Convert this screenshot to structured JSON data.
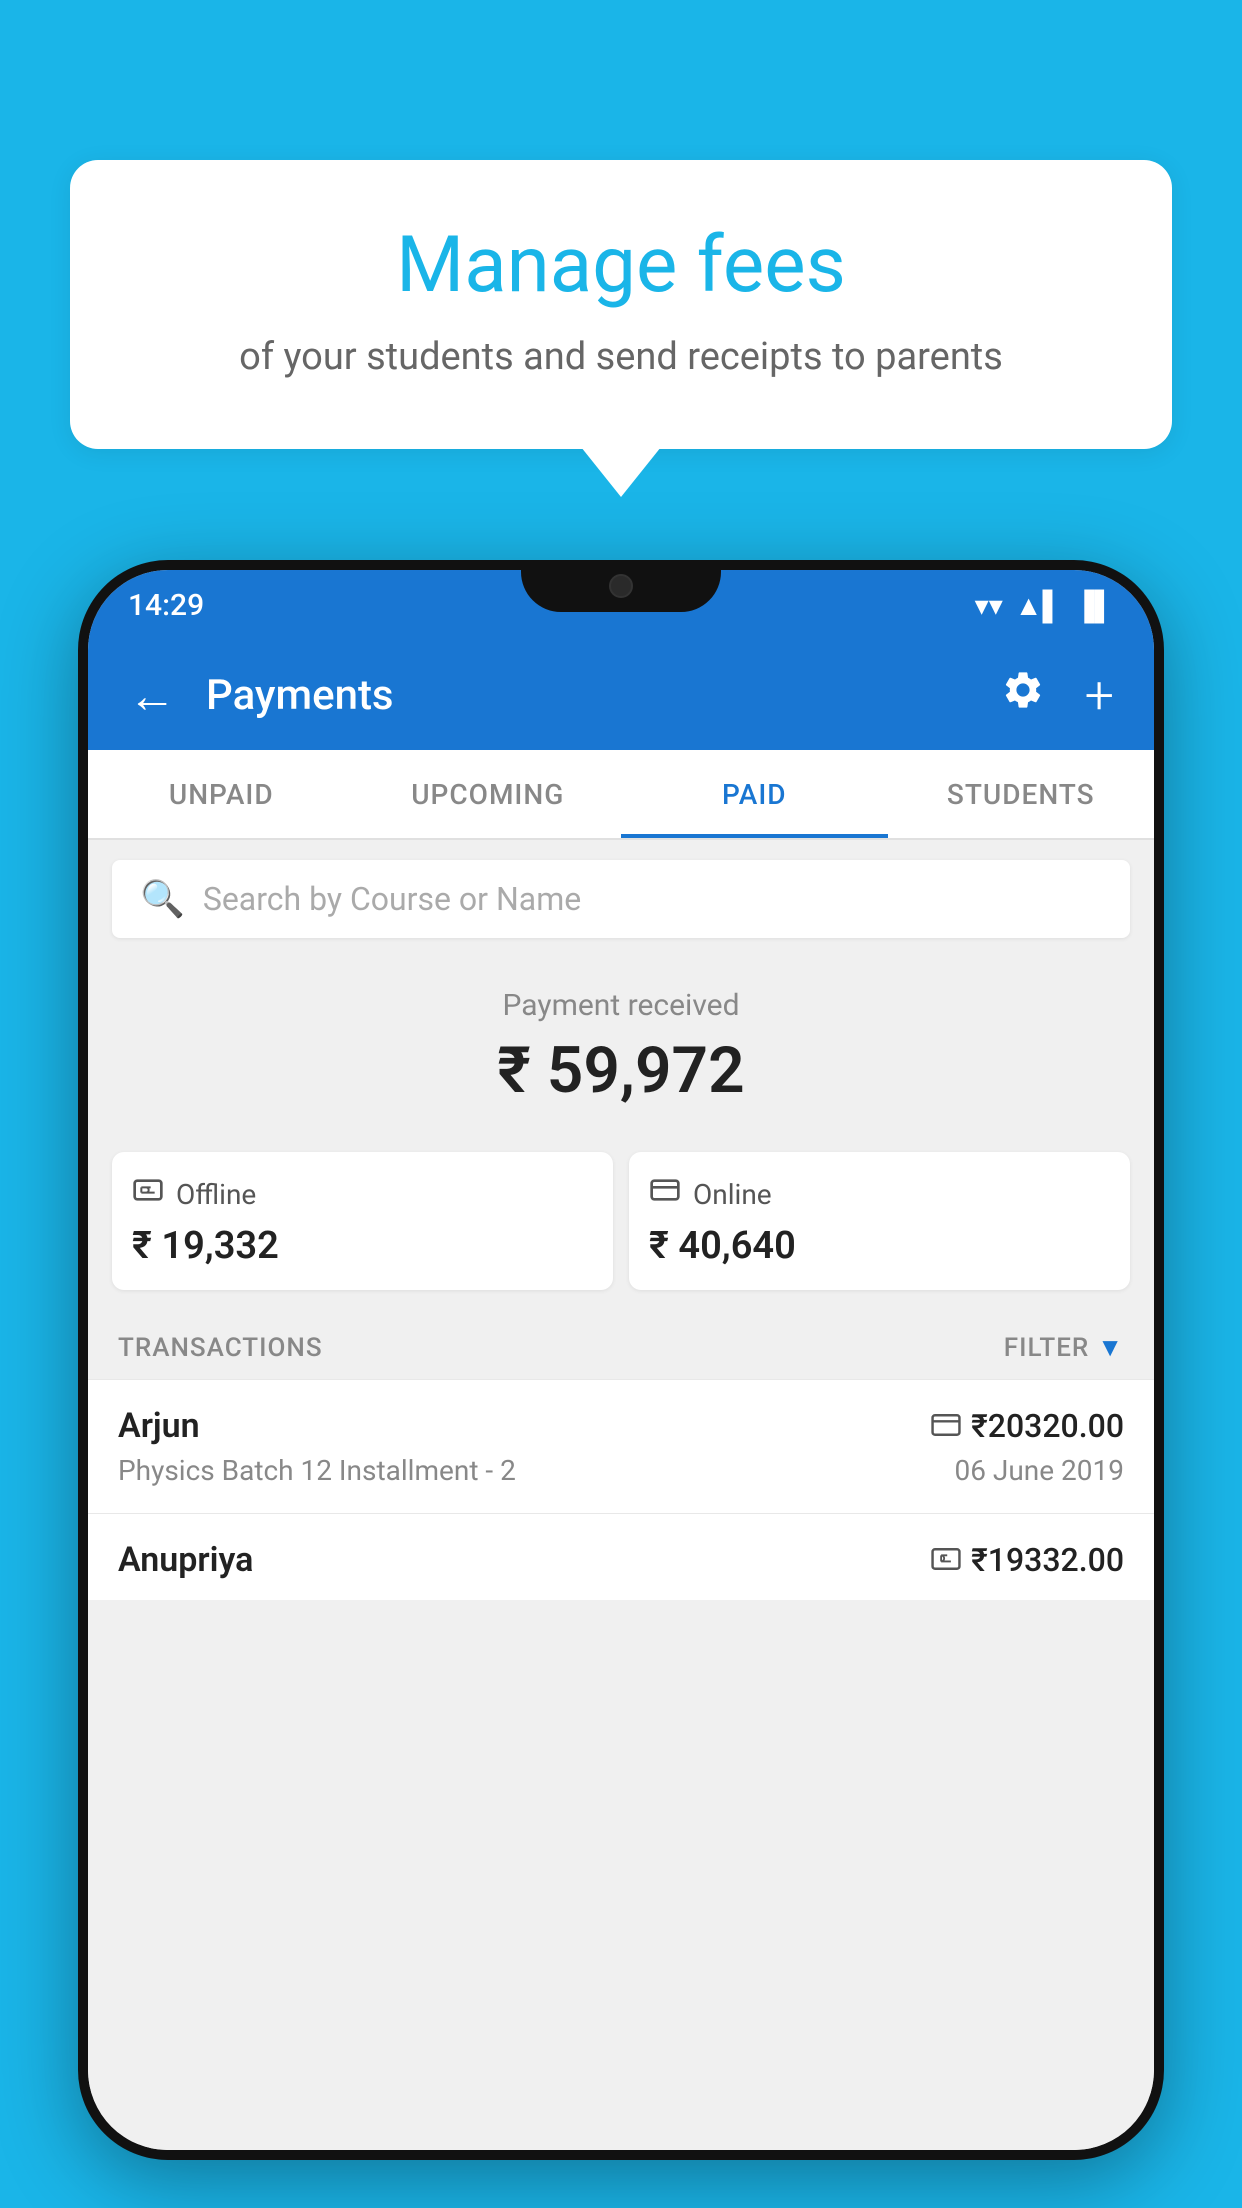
{
  "background_color": "#1ab5e8",
  "bubble": {
    "title": "Manage fees",
    "subtitle": "of your students and send receipts to parents"
  },
  "status_bar": {
    "time": "14:29",
    "wifi": "▼",
    "signal": "▲",
    "battery": "▐"
  },
  "app_bar": {
    "title": "Payments",
    "back_label": "←",
    "settings_label": "⚙",
    "add_label": "+"
  },
  "tabs": [
    {
      "label": "UNPAID",
      "active": false
    },
    {
      "label": "UPCOMING",
      "active": false
    },
    {
      "label": "PAID",
      "active": true
    },
    {
      "label": "STUDENTS",
      "active": false
    }
  ],
  "search": {
    "placeholder": "Search by Course or Name"
  },
  "payment_received": {
    "label": "Payment received",
    "amount": "₹ 59,972",
    "offline": {
      "type": "Offline",
      "amount": "₹ 19,332"
    },
    "online": {
      "type": "Online",
      "amount": "₹ 40,640"
    }
  },
  "transactions": {
    "header_label": "TRANSACTIONS",
    "filter_label": "FILTER",
    "rows": [
      {
        "name": "Arjun",
        "course": "Physics Batch 12 Installment - 2",
        "amount": "₹20320.00",
        "date": "06 June 2019",
        "payment_type": "online"
      },
      {
        "name": "Anupriya",
        "course": "",
        "amount": "₹19332.00",
        "date": "",
        "payment_type": "offline"
      }
    ]
  }
}
